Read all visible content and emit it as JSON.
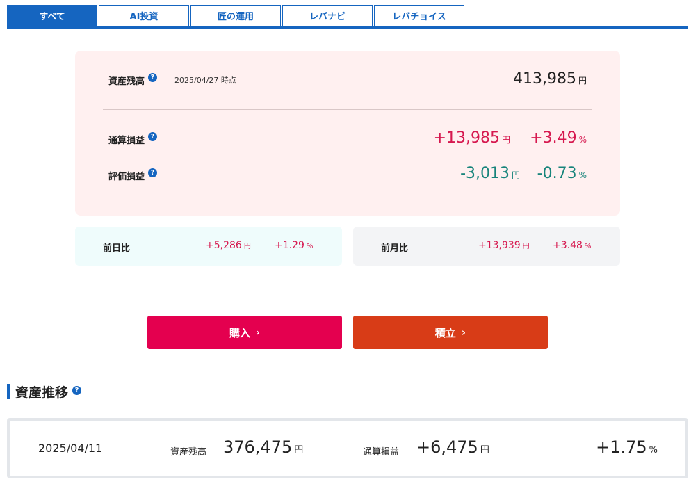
{
  "tabs": [
    {
      "label": "すべて",
      "active": true
    },
    {
      "label": "AI投資",
      "active": false
    },
    {
      "label": "匠の運用",
      "active": false
    },
    {
      "label": "レバナビ",
      "active": false
    },
    {
      "label": "レバチョイス",
      "active": false
    }
  ],
  "summary": {
    "balance_label": "資産残高",
    "as_of": "2025/04/27 時点",
    "balance_value": "413,985",
    "unit_yen": "円",
    "unit_pct": "%",
    "total_pl_label": "通算損益",
    "total_pl_value": "+13,985",
    "total_pl_pct": "+3.49",
    "valuation_pl_label": "評価損益",
    "valuation_pl_value": "-3,013",
    "valuation_pl_pct": "-0.73"
  },
  "comparison": {
    "day": {
      "label": "前日比",
      "value": "+5,286",
      "pct": "+1.29"
    },
    "month": {
      "label": "前月比",
      "value": "+13,939",
      "pct": "+3.48"
    }
  },
  "actions": {
    "buy_label": "購入",
    "accumulate_label": "積立"
  },
  "history": {
    "section_title": "資産推移",
    "date": "2025/04/11",
    "balance_label": "資産残高",
    "balance_value": "376,475",
    "pl_label": "通算損益",
    "pl_value": "+6,475",
    "pl_pct": "+1.75"
  },
  "colors": {
    "brand_blue": "#1565c0",
    "positive": "#d6184f",
    "negative": "#17847b",
    "buy_button": "#e4004f",
    "accumulate_button": "#d83c17"
  },
  "icons": {
    "help": "question-circle-icon",
    "chevron": "chevron-right-icon"
  }
}
